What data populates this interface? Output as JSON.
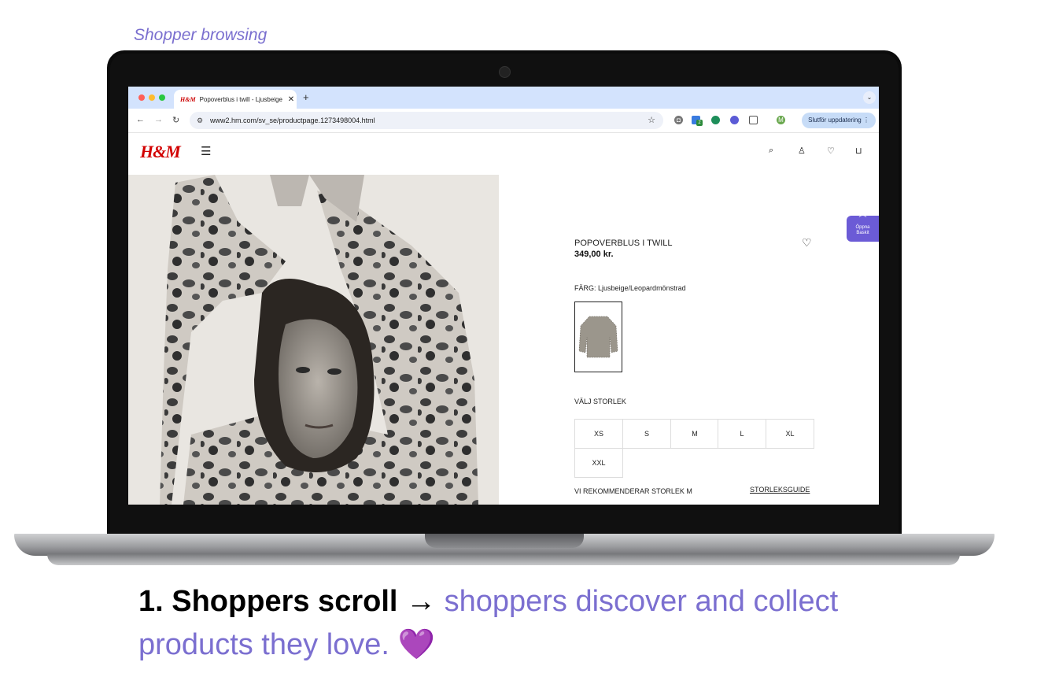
{
  "caption_top": "Shopper browsing",
  "browser": {
    "tab_title": "Popoverblus i twill - Ljusbeige",
    "tab_favicon_text": "H&M",
    "new_tab_icon": "plus-icon",
    "url": "www2.hm.com/sv_se/productpage.1273498004.html",
    "update_button": "Slutför uppdatering",
    "extension_badge": "2",
    "profile_initial": "M"
  },
  "site": {
    "logo": "H&M",
    "product_title": "POPOVERBLUS I TWILL",
    "price": "349,00 kr.",
    "color_label": "FÄRG: Ljusbeige/Leopardmönstrad",
    "size_label": "VÄLJ STORLEK",
    "sizes": [
      "XS",
      "S",
      "M",
      "L",
      "XL",
      "XXL"
    ],
    "recommend": "VI REKOMMENDERAR STORLEK M",
    "size_guide": "STORLEKSGUIDE",
    "widget_label": "Öppna Baskit"
  },
  "caption_bottom": {
    "bold": "1. Shoppers scroll",
    "arrow": "→",
    "rest": "shoppers discover and collect products they love.",
    "emoji": "💜"
  },
  "colors": {
    "accent": "#7a6fcf",
    "brand_red": "#d20000",
    "widget": "#6b5bd6"
  }
}
